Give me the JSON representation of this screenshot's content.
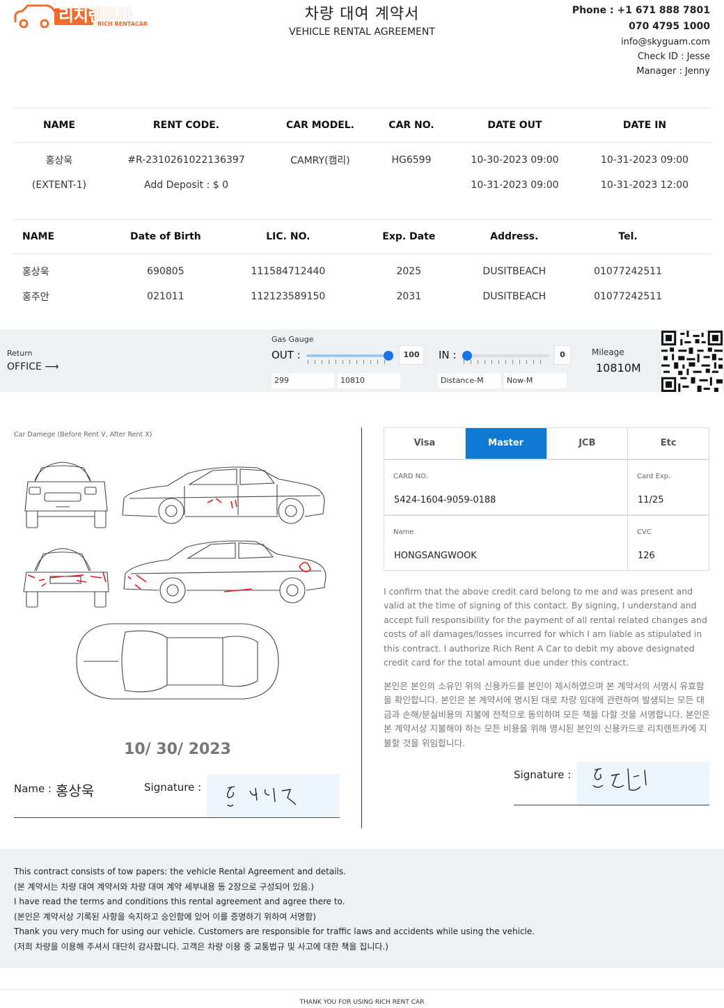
{
  "brand": {
    "name_ko": "리치렌트카",
    "name_en": "RICH RENTACAR",
    "color": "#ef6c2a"
  },
  "title": {
    "ko": "차량 대여 계약서",
    "en": "VEHICLE RENTAL AGREEMENT"
  },
  "contact": {
    "phone": "Phone : +1 671 888 7801",
    "phone2": "070 4795 1000",
    "email": "info@skyguam.com",
    "check_id": "Check ID : Jesse",
    "manager": "Manager : Jenny"
  },
  "rental": {
    "headers": [
      "NAME",
      "RENT CODE.",
      "CAR MODEL.",
      "CAR NO.",
      "DATE OUT",
      "DATE IN"
    ],
    "row1": [
      "홍상욱",
      "#R-2310261022136397",
      "CAMRY(캠리)",
      "HG6599",
      "10-30-2023 09:00",
      "10-31-2023 09:00"
    ],
    "row2": [
      "(EXTENT-1)",
      "Add Deposit :  $ 0",
      "",
      "",
      "10-31-2023 09:00",
      "10-31-2023 12:00"
    ]
  },
  "drivers": {
    "headers": [
      "NAME",
      "Date of Birth",
      "LIC. NO.",
      "Exp. Date",
      "Address.",
      "Tel."
    ],
    "rows": [
      [
        "홍상욱",
        "690805",
        "111584712440",
        "2025",
        "DUSITBEACH",
        "01077242511"
      ],
      [
        "홍주안",
        "021011",
        "112123589150",
        "2031",
        "DUSITBEACH",
        "01077242511"
      ]
    ]
  },
  "gauge": {
    "return_label": "Return",
    "return_value": "OFFICE",
    "gas_label": "Gas Gauge",
    "out_label": "OUT :",
    "out_value": "100",
    "out_level": 1.0,
    "in_label": "IN :",
    "in_value": "0",
    "in_level": 0.0,
    "out_dist": "299",
    "out_now": "10810",
    "in_dist": "Distance-M",
    "in_now": "Now-M",
    "mileage_label": "Mileage",
    "mileage_value": "10810M"
  },
  "damage": {
    "caption": "Car Damege (Before Rent V, After Rent X)",
    "date": "10/ 30/ 2023",
    "name_label": "Name :",
    "name_value": "홍상욱",
    "signature_label": "Signature :"
  },
  "card": {
    "tabs": [
      "Visa",
      "Master",
      "JCB",
      "Etc"
    ],
    "selected": "Master",
    "no_label": "CARD NO.",
    "no_value": "5424-1604-9059-0188",
    "exp_label": "Card Exp.",
    "exp_value": "11/25",
    "name_label": "Name",
    "name_value": "HONGSANGWOOK",
    "cvc_label": "CVC",
    "cvc_value": "126",
    "accent": "#0f78d2"
  },
  "consent": {
    "en": "I confirm that the above credit card belong to me and was present and valid at the time of signing of this contact. By signing, I understand and accept full responsibility for the payment of all rental related changes and costs of all damages/losses incurred for which I am liable as stipulated in this contract. I authorize Rich Rent A Car to debit my above designated credit card for the total amount due under this contract.",
    "ko": "본인은 본인의 소유인 위의 신용카드를 본인이 제시하였으며 본 계약서의 서명시 유효함을 확인합니다. 본인은 본 계약서에 명시된 대로 차량 임대에 관련하여 발생되는 모든 대금과 손해/분실비용의 지불에 전적으로 동의하며 모든 책을 다할 것을 서명합니다. 본인은 본 계약서상 지불해야 하는 모든 비용을 위해 명시된 본인의 신용카드로 리치렌트카에 지불할 것을 위임합니다.",
    "signature_label": "Signature :"
  },
  "footer": {
    "l1": "This contract consists of tow papers: the vehicle Rental Agreement and details.",
    "l2": "(본 계약서는 차량 대여 계약서와 차량 대여 계약 세부내용 등 2장으로 구성되어 있음.)",
    "l3": "I have read the terms and conditions this rental agreement and agree there to.",
    "l4": "(본인은 계약서상 기록된 사항을 숙지하고 승인함에 있어 이를 증명하기 위하여 서명함)",
    "l5": "Thank you very much for using our vehicle. Customers are responsible for traffic laws and accidents while using the vehicle.",
    "l6": "(저희 차량을 이용해 주셔서 대단히 감사합니다. 고객은 차량 이용 중 교통법규 및 사고에 대한 책을 집니다.)",
    "thanks": "THANK YOU FOR USING RICH RENT CAR"
  }
}
